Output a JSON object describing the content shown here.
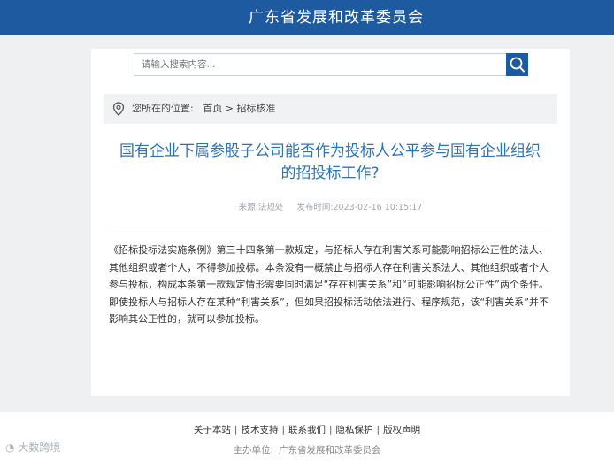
{
  "header": {
    "title": "广东省发展和改革委员会"
  },
  "search": {
    "placeholder": "请输入搜索内容..."
  },
  "breadcrumb": {
    "label": "您所在的位置:",
    "home": "首页",
    "separator": ">",
    "current": "招标核准"
  },
  "article": {
    "title": "国有企业下属参股子公司能否作为投标人公平参与国有企业组织的招投标工作?",
    "source": "来源:法规处",
    "published": "发布时间:2023-02-16 10:15:17",
    "body": "《招标投标法实施条例》第三十四条第一款规定，与招标人存在利害关系可能影响招标公正性的法人、其他组织或者个人，不得参加投标。本条没有一概禁止与招标人存在利害关系法人、其他组织或者个人参与投标，构成本条第一款规定情形需要同时满足“存在利害关系”和“可能影响招标公正性”两个条件。即使投标人与招标人存在某种“利害关系”，但如果招投标活动依法进行、程序规范，该“利害关系”并不影响其公正性的，就可以参加投标。"
  },
  "footer": {
    "links": [
      "关于本站",
      "技术支持",
      "联系我们",
      "隐私保护",
      "版权声明"
    ],
    "host_label": "主办单位:",
    "host_name": "广东省发展和改革委员会"
  },
  "watermark": "大数跨境",
  "colors": {
    "brand": "#1e5aa0",
    "title": "#2c73b8"
  },
  "icons": {
    "search": "search-icon",
    "location": "location-pin-icon"
  }
}
